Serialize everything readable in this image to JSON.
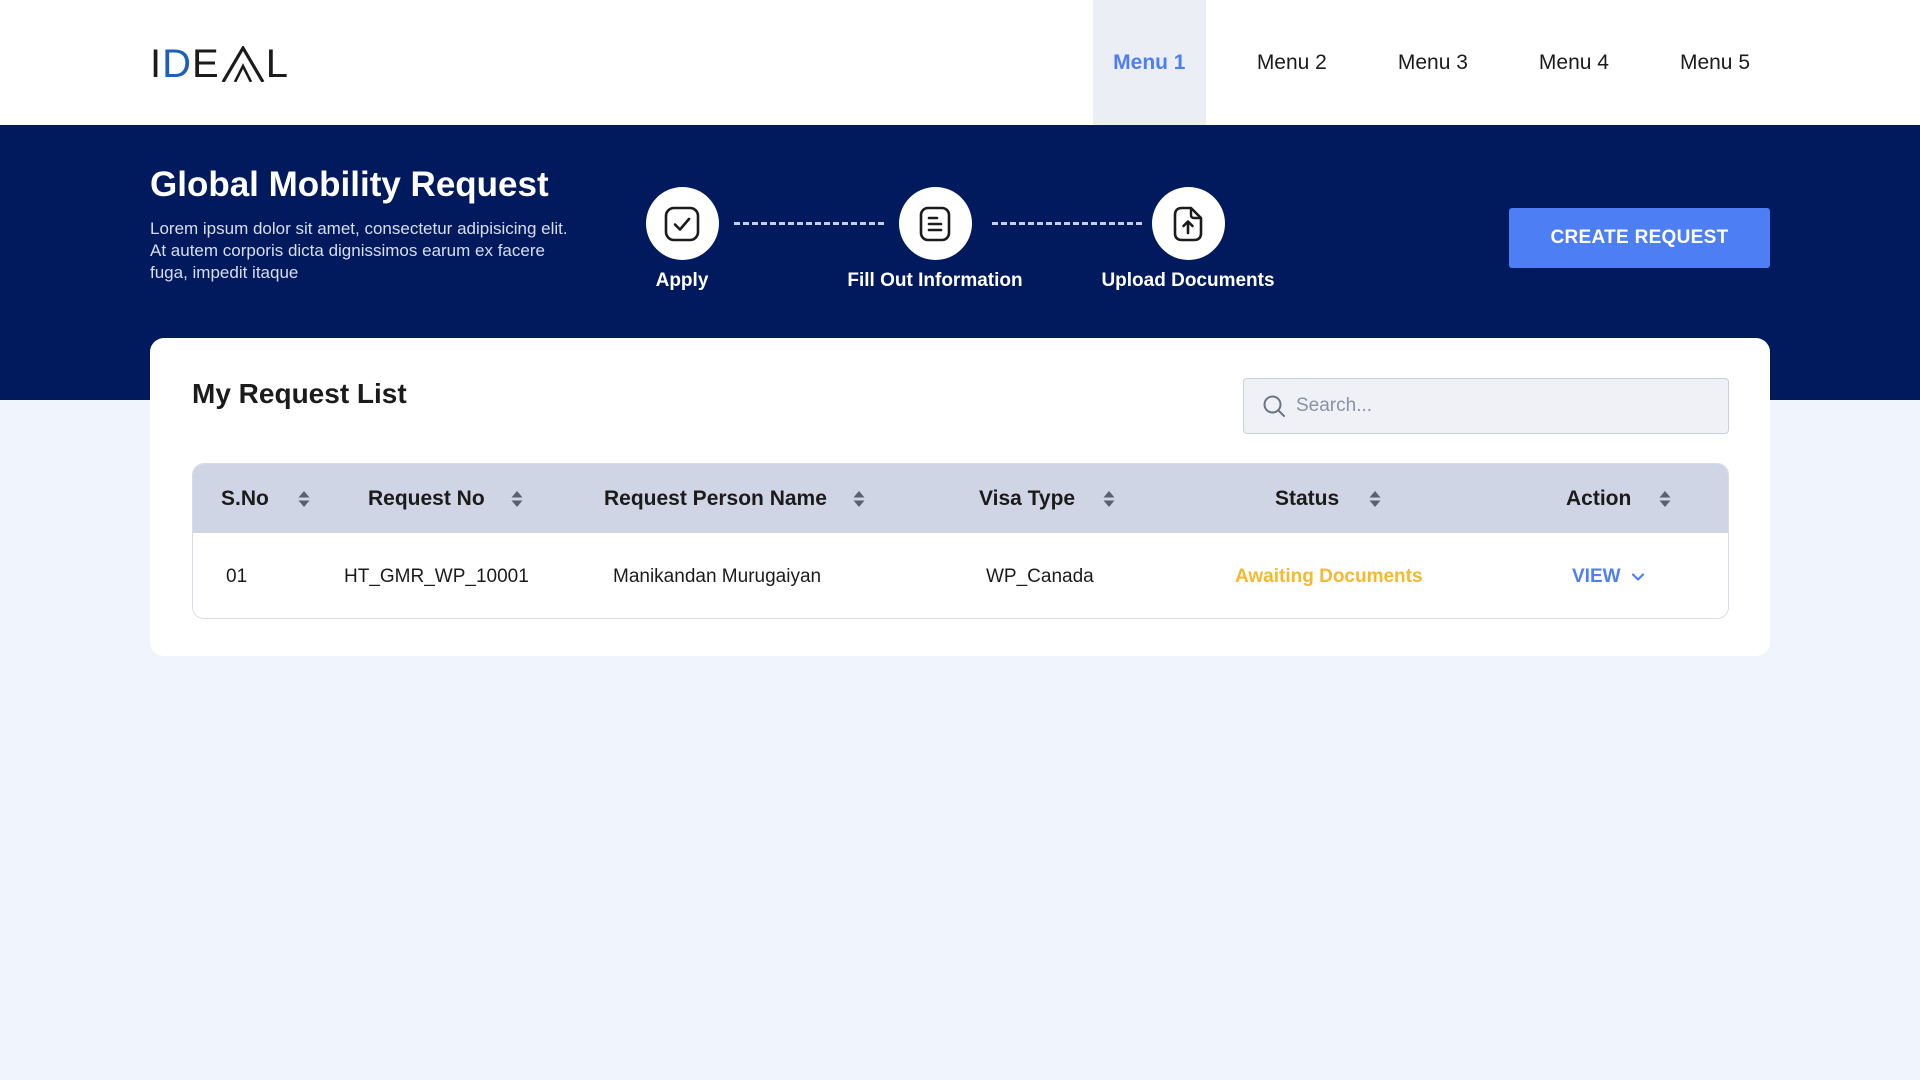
{
  "header": {
    "logo": {
      "letters": [
        "I",
        "D",
        "E",
        "A",
        "L"
      ],
      "accent_color": "#1f5fb8"
    },
    "nav": [
      {
        "label": "Menu 1",
        "active": true
      },
      {
        "label": "Menu 2",
        "active": false
      },
      {
        "label": "Menu 3",
        "active": false
      },
      {
        "label": "Menu 4",
        "active": false
      },
      {
        "label": "Menu 5",
        "active": false
      }
    ]
  },
  "banner": {
    "title": "Global Mobility Request",
    "description": "Lorem ipsum dolor sit amet, consectetur adipisicing elit. At autem corporis dicta dignissimos earum ex facere fuga, impedit itaque",
    "steps": [
      {
        "label": "Apply",
        "icon": "check-square-icon"
      },
      {
        "label": "Fill Out Information",
        "icon": "form-lines-icon"
      },
      {
        "label": "Upload Documents",
        "icon": "upload-file-icon"
      }
    ],
    "create_button": "CREATE REQUEST"
  },
  "request_list": {
    "title": "My Request List",
    "search_placeholder": "Search...",
    "columns": [
      "S.No",
      "Request No",
      "Request Person Name",
      "Visa Type",
      "Status",
      "Action"
    ],
    "rows": [
      {
        "sno": "01",
        "request_no": "HT_GMR_WP_10001",
        "person_name": "Manikandan Murugaiyan",
        "visa_type": "WP_Canada",
        "status": "Awaiting Documents",
        "action": "VIEW"
      }
    ]
  },
  "colors": {
    "banner_bg": "#011a5e",
    "accent": "#4e7ef4",
    "status_awaiting": "#f5b82e",
    "table_header_bg": "#d0d5e5",
    "page_bg": "#f0f4fd"
  }
}
